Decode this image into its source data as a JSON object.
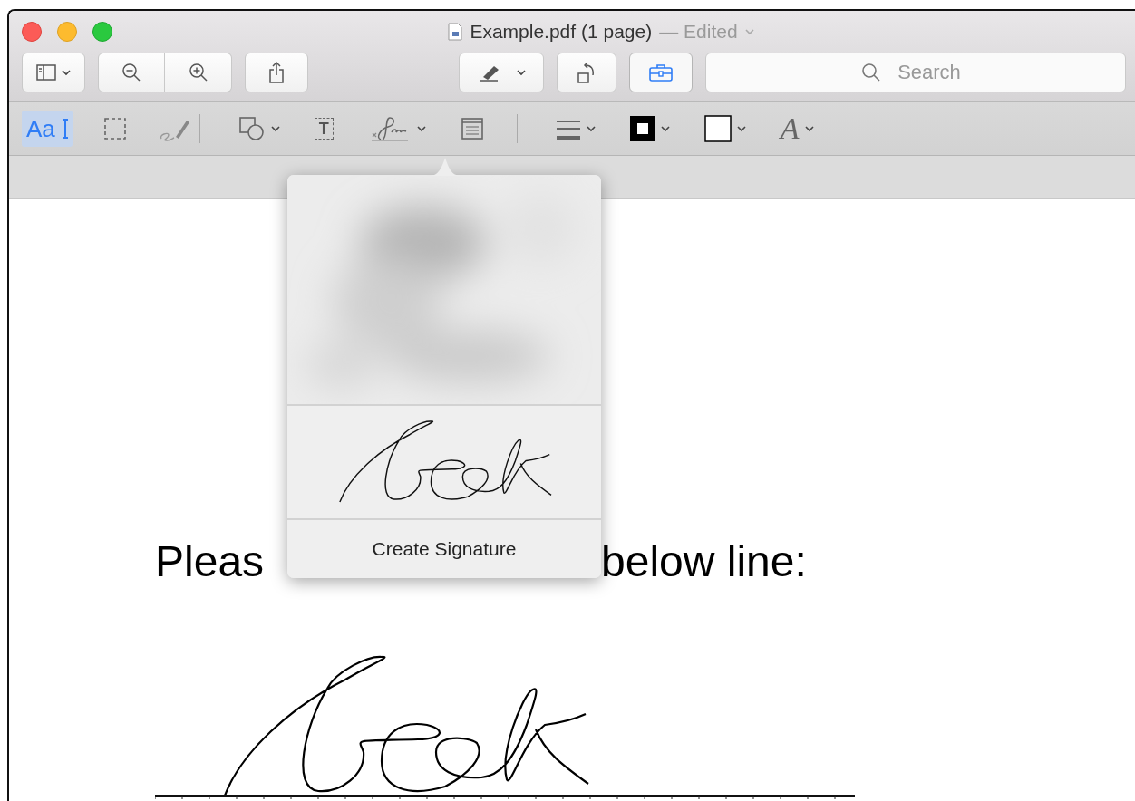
{
  "window": {
    "title": "Example.pdf (1 page)",
    "status": "— Edited"
  },
  "toolbar": {
    "buttons": [
      {
        "kind": "sidebar",
        "on": false
      },
      {
        "kind": "zoom-out",
        "on": false
      },
      {
        "kind": "zoom-in",
        "on": false
      },
      {
        "kind": "share",
        "on": false
      },
      {
        "kind": "highlight",
        "on": false
      },
      {
        "kind": "rotate",
        "on": false
      },
      {
        "kind": "markup",
        "on": true
      }
    ],
    "search": {
      "placeholder": "Search"
    }
  },
  "markup_toolbar": {
    "tools": [
      {
        "kind": "text-select",
        "label": "Aa",
        "selected": true
      },
      {
        "kind": "rect-select",
        "selected": false
      },
      {
        "kind": "sketch",
        "selected": false
      },
      {
        "kind": "separator"
      },
      {
        "kind": "shapes",
        "selected": false
      },
      {
        "kind": "text-box",
        "label": "T",
        "selected": false
      },
      {
        "kind": "sign",
        "selected": false
      },
      {
        "kind": "note",
        "selected": false
      },
      {
        "kind": "separator"
      },
      {
        "kind": "line-style",
        "selected": false
      },
      {
        "kind": "border-color",
        "selected": false
      },
      {
        "kind": "fill-color",
        "selected": false
      },
      {
        "kind": "font",
        "label": "A",
        "selected": false
      }
    ]
  },
  "signature_popover": {
    "items": [
      {
        "kind": "picture"
      },
      {
        "kind": "signature"
      }
    ],
    "action": "Create Signature"
  },
  "document": {
    "instruction_start": "Pleas",
    "instruction_end": "below line:",
    "signed": true
  }
}
